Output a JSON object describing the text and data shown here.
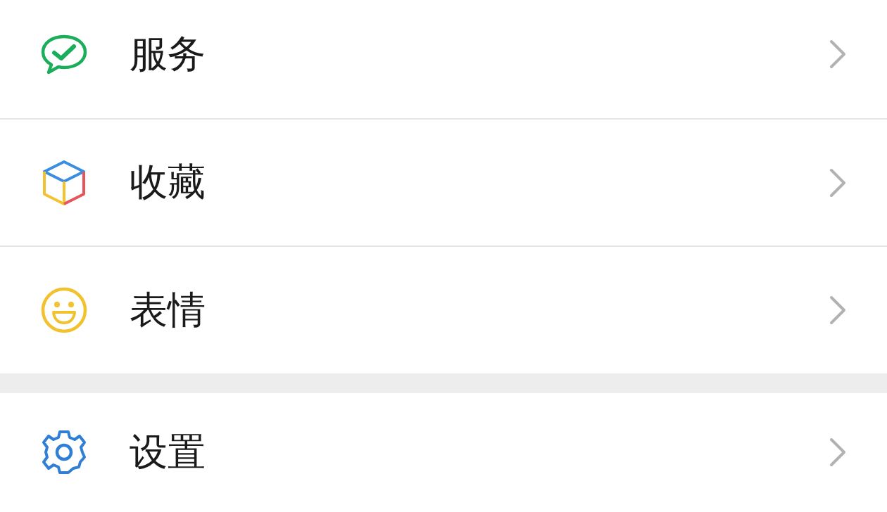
{
  "sections": [
    {
      "items": [
        {
          "kind": "wallet",
          "label": "服务"
        },
        {
          "kind": "cube",
          "label": "收藏"
        },
        {
          "kind": "smile",
          "label": "表情"
        }
      ]
    },
    {
      "items": [
        {
          "kind": "gear",
          "label": "设置"
        }
      ]
    }
  ]
}
